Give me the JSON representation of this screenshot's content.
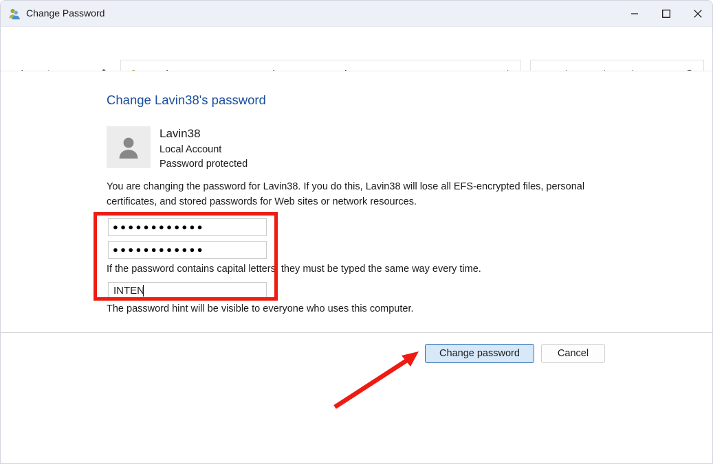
{
  "window": {
    "title": "Change Password",
    "title_icon": "user-accounts-icon",
    "controls": {
      "minimize": "minimize-icon",
      "maximize": "maximize-icon",
      "close": "close-icon"
    }
  },
  "navbar": {
    "back": "back-arrow-icon",
    "forward": "forward-arrow-icon",
    "recent": "recent-locations-chevron-icon",
    "up": "up-arrow-icon",
    "breadcrumb": {
      "icon": "user-accounts-icon",
      "root_chevron": "«",
      "items": [
        {
          "label": "Change an Account"
        },
        {
          "label": "Change Password"
        }
      ],
      "separator": "›",
      "dropdown_icon": "chevron-down-icon",
      "refresh_icon": "refresh-icon"
    },
    "search": {
      "placeholder": "Search Control Panel",
      "value": "",
      "icon": "search-icon"
    }
  },
  "main": {
    "page_title": "Change Lavin38's password",
    "account": {
      "avatar_icon": "user-avatar-icon",
      "name": "Lavin38",
      "type": "Local Account",
      "status": "Password protected"
    },
    "warning_text": "You are changing the password for Lavin38.  If you do this, Lavin38 will lose all EFS-encrypted files, personal certificates, and stored passwords for Web sites or network resources.",
    "fields": {
      "new_password": {
        "name": "new-password-input",
        "masked_value": "●●●●●●●●●●●●",
        "char_count": 12,
        "placeholder": ""
      },
      "confirm_password": {
        "name": "confirm-password-input",
        "masked_value": "●●●●●●●●●●●●",
        "char_count": 12,
        "placeholder": ""
      },
      "password_hint": {
        "name": "password-hint-input",
        "value": "INTEN",
        "placeholder": "",
        "focused": true
      }
    },
    "caps_note": "If the password contains capital letters, they must be typed the same way every time.",
    "hint_note": "The password hint will be visible to everyone who uses this computer."
  },
  "footer": {
    "change_password_label": "Change password",
    "cancel_label": "Cancel"
  },
  "annotations": {
    "highlight_box_color": "#ee1b12",
    "arrow_color": "#ee1b12",
    "arrow_target": "change-password-button"
  },
  "colors": {
    "titlebar": "#eef0f8",
    "page_title_blue": "#1a4fa0",
    "focus_underline": "#1668c9",
    "default_button_fill": "#d7e8f8",
    "default_button_border": "#2f6fb5"
  }
}
